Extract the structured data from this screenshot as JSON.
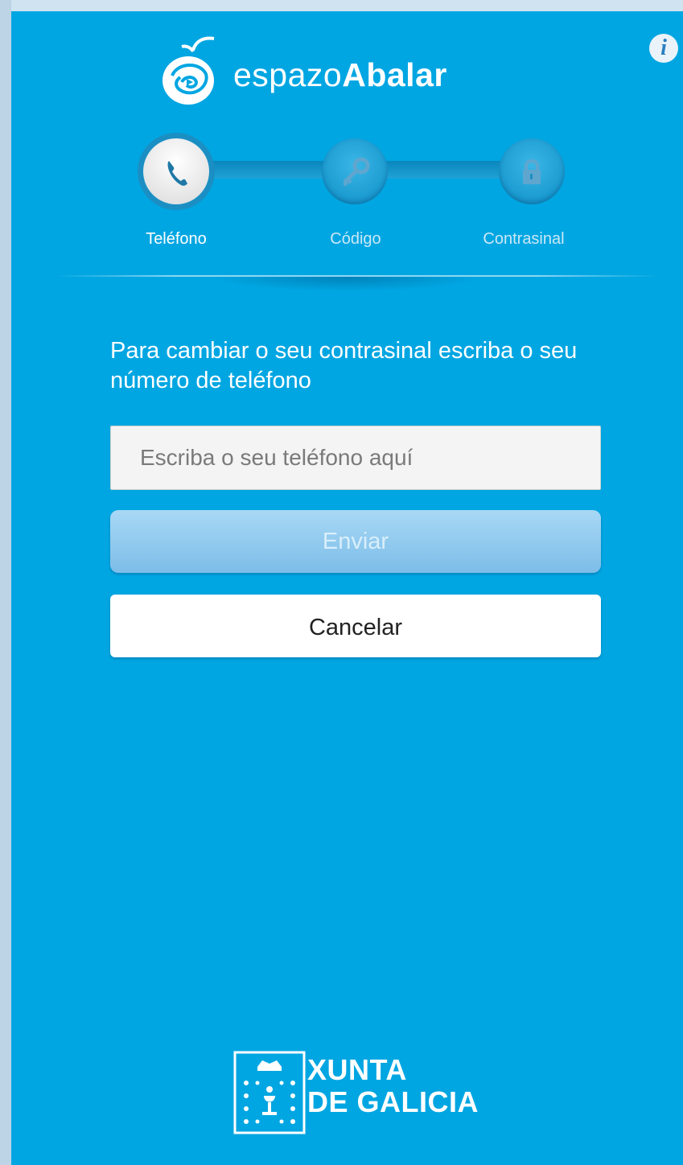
{
  "app": {
    "logo_light": "espazo",
    "logo_bold": "Abalar",
    "info_icon": "info-icon"
  },
  "colors": {
    "background": "#00a6e2",
    "send_button": "#8ccaf0",
    "cancel_button": "#ffffff"
  },
  "steps": [
    {
      "label": "Teléfono",
      "icon": "phone-icon",
      "active": true
    },
    {
      "label": "Código",
      "icon": "key-icon",
      "active": false
    },
    {
      "label": "Contrasinal",
      "icon": "lock-icon",
      "active": false
    }
  ],
  "form": {
    "instruction": "Para cambiar o seu contrasinal escriba o seu número de teléfono",
    "phone_placeholder": "Escriba o seu teléfono aquí",
    "phone_value": "",
    "send_label": "Enviar",
    "cancel_label": "Cancelar"
  },
  "footer": {
    "line1": "XUNTA",
    "line2": "DE GALICIA"
  }
}
